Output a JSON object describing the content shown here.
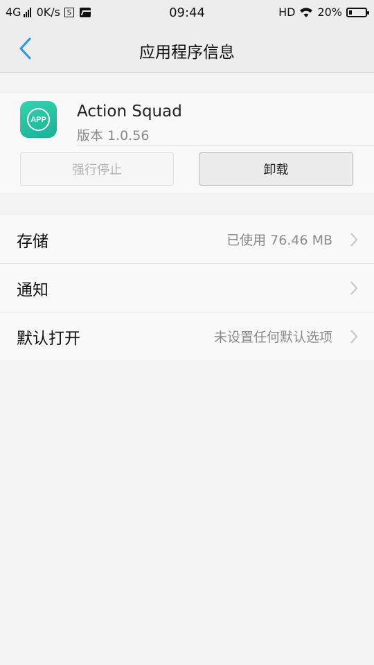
{
  "status_bar": {
    "network": "4G",
    "speed": "0K/s",
    "sim_icon_letter": "S",
    "time": "09:44",
    "hd": "HD",
    "battery_pct": "20%",
    "battery_level": 0.2,
    "icons": [
      "signal-icon",
      "sim-icon",
      "image-icon",
      "wifi-icon",
      "battery-icon"
    ]
  },
  "header": {
    "title": "应用程序信息",
    "back_icon": "chevron-left-icon",
    "accent_color": "#2196f3"
  },
  "app": {
    "icon_text": "APP",
    "name": "Action Squad",
    "version": "版本 1.0.56",
    "icon_colors": [
      "#36d3b0",
      "#17b292"
    ]
  },
  "buttons": {
    "force_stop": "强行停止",
    "uninstall": "卸载"
  },
  "settings": [
    {
      "label": "存储",
      "value": "已使用 76.46 MB"
    },
    {
      "label": "通知",
      "value": ""
    },
    {
      "label": "默认打开",
      "value": "未设置任何默认选项"
    }
  ]
}
